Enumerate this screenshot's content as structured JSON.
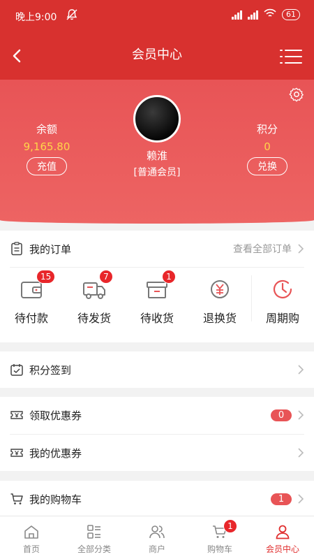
{
  "status_bar": {
    "time": "晚上9:00",
    "battery": "61"
  },
  "nav": {
    "title": "会员中心"
  },
  "profile": {
    "balance_label": "余额",
    "balance_value": "9,165.80",
    "recharge_label": "充值",
    "points_label": "积分",
    "points_value": "0",
    "exchange_label": "兑换",
    "username": "赖淮",
    "member_level": "[普通会员]"
  },
  "orders": {
    "title": "我的订单",
    "view_all": "查看全部订单",
    "items": [
      {
        "label": "待付款",
        "badge": "15"
      },
      {
        "label": "待发货",
        "badge": "7"
      },
      {
        "label": "待收货",
        "badge": "1"
      },
      {
        "label": "退换货",
        "badge": ""
      },
      {
        "label": "周期购",
        "badge": ""
      }
    ]
  },
  "menu": {
    "checkin": "积分签到",
    "get_coupons": "领取优惠券",
    "get_coupons_count": "0",
    "my_coupons": "我的优惠券",
    "cart": "我的购物车",
    "cart_count": "1"
  },
  "tabbar": {
    "items": [
      {
        "label": "首页",
        "icon": "home-icon"
      },
      {
        "label": "全部分类",
        "icon": "category-icon"
      },
      {
        "label": "商户",
        "icon": "merchant-icon"
      },
      {
        "label": "购物车",
        "icon": "cart-icon",
        "badge": "1"
      },
      {
        "label": "会员中心",
        "icon": "member-icon"
      }
    ],
    "active_color": "#e02e2e"
  },
  "colors": {
    "brand_red": "#d8312f",
    "badge_red": "#e8262a",
    "gold": "#ffd54a"
  }
}
